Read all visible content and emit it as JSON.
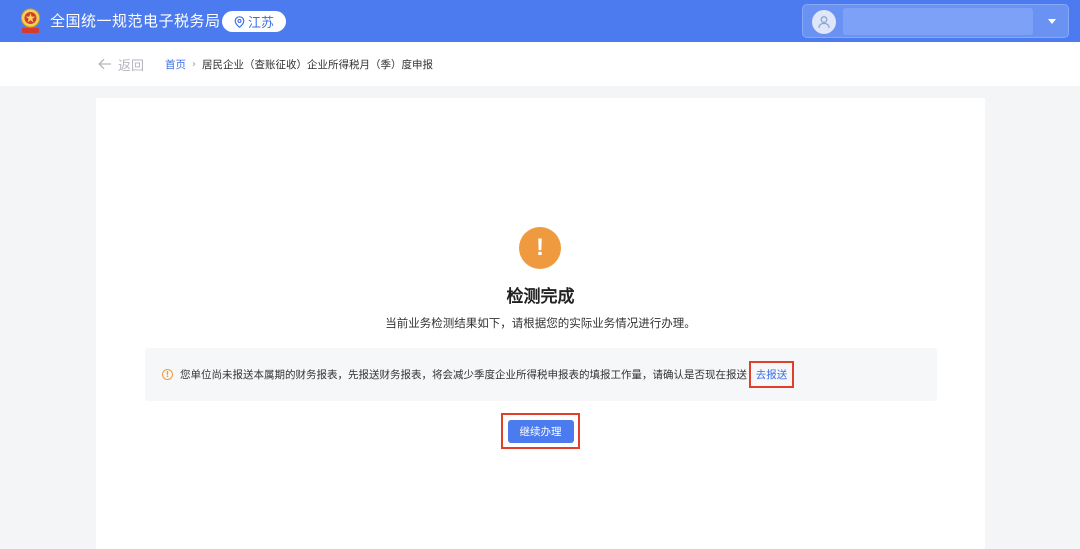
{
  "header": {
    "title": "全国统一规范电子税务局",
    "region": "江苏",
    "user_name": "",
    "colors": {
      "bar": "#4c7bf0"
    }
  },
  "breadcrumb": {
    "back_label": "返回",
    "home": "首页",
    "separator": "›",
    "current": "居民企业（查账征收）企业所得税月（季）度申报"
  },
  "result": {
    "icon": "exclamation-icon",
    "icon_glyph": "!",
    "title": "检测完成",
    "subtitle": "当前业务检测结果如下，请根据您的实际业务情况进行办理。"
  },
  "notice": {
    "icon": "info-warning-icon",
    "icon_glyph": "!",
    "text": "您单位尚未报送本属期的财务报表，先报送财务报表，将会减少季度企业所得税申报表的填报工作量，请确认是否现在报送",
    "link_label": "去报送"
  },
  "actions": {
    "continue_label": "继续办理"
  },
  "colors": {
    "accent": "#4c7bf0",
    "warning": "#ef9a3f",
    "highlight_border": "#e0402a"
  }
}
